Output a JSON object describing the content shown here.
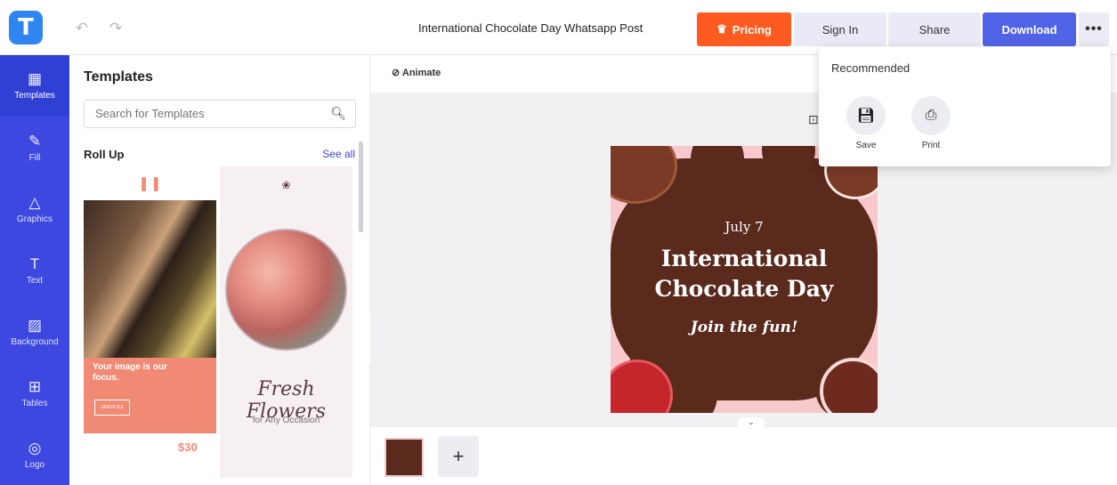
{
  "header": {
    "logo": "T",
    "doc_title": "International Chocolate Day Whatsapp Post",
    "pricing_label": "Pricing",
    "signin_label": "Sign In",
    "share_label": "Share",
    "download_label": "Download",
    "more_label": "•••"
  },
  "sidebar": {
    "items": [
      {
        "label": "Templates",
        "icon": "templates-icon"
      },
      {
        "label": "Fill",
        "icon": "fill-icon"
      },
      {
        "label": "Graphics",
        "icon": "graphics-icon"
      },
      {
        "label": "Text",
        "icon": "text-icon"
      },
      {
        "label": "Background",
        "icon": "background-icon"
      },
      {
        "label": "Tables",
        "icon": "tables-icon"
      },
      {
        "label": "Logo",
        "icon": "logo-icon"
      }
    ]
  },
  "panel": {
    "title": "Templates",
    "search_placeholder": "Search for Templates",
    "section_label": "Roll Up",
    "see_all": "See all"
  },
  "template1": {
    "headline": "Your image is our focus.",
    "services": "SERVICES",
    "price": "$30"
  },
  "template2": {
    "script": "Fresh Flowers",
    "sub": "for Any Occasion"
  },
  "toolbar": {
    "animate_label": "Animate"
  },
  "design": {
    "date": "July 7",
    "title_line1": "International",
    "title_line2": "Chocolate Day",
    "tagline": "Join the fun!"
  },
  "dropdown": {
    "heading": "Recommended",
    "save_label": "Save",
    "print_label": "Print"
  },
  "colors": {
    "rail": "#3c48e0",
    "pricing": "#ff5a1f",
    "download": "#5163e6",
    "chocolate": "#5a2a1c",
    "pink": "#f8c9cc"
  }
}
